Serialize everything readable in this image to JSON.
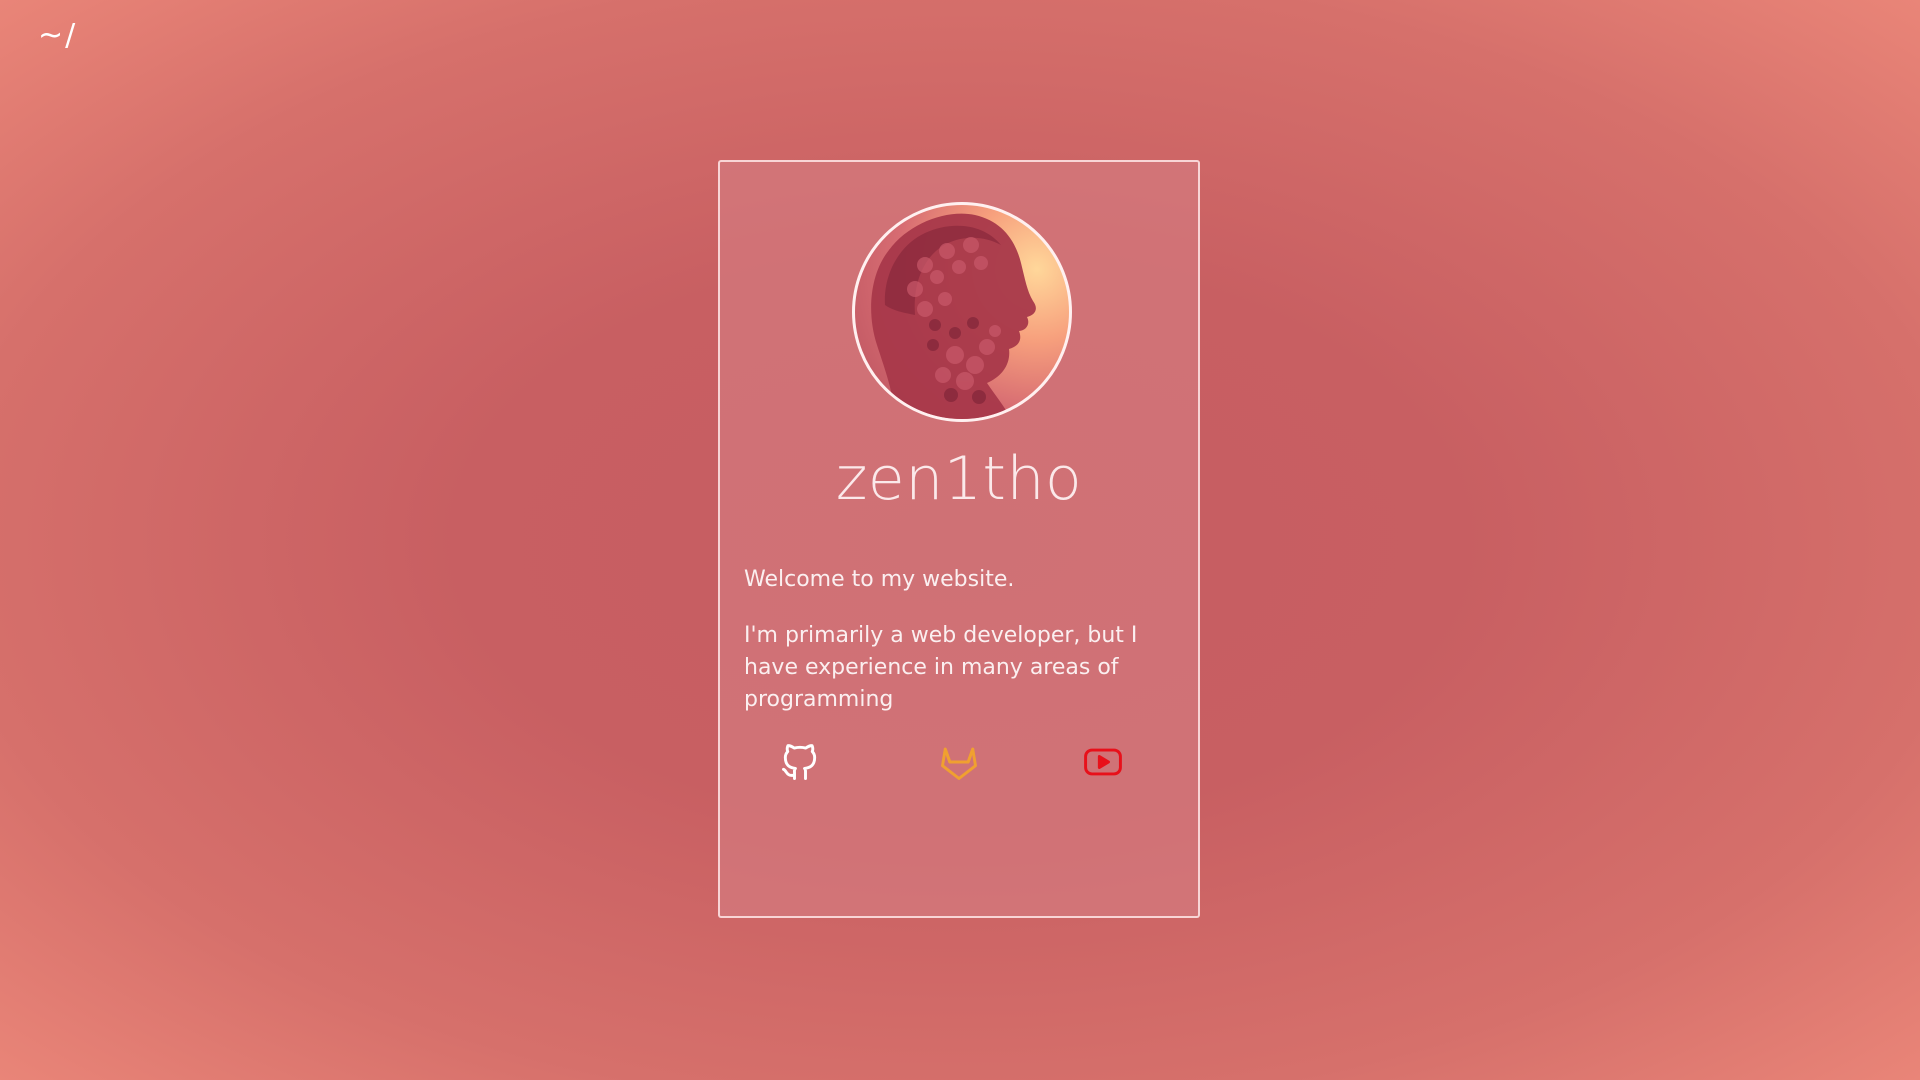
{
  "nav": {
    "home_link": "~/"
  },
  "profile": {
    "name": "zen1tho",
    "welcome": "Welcome to my website.",
    "bio": "I'm primarily a web developer, but I have experience in many areas of programming",
    "avatar_icon": "classical-bust-portrait"
  },
  "socials": [
    {
      "name": "github",
      "icon": "github-icon",
      "color": "#ffffff"
    },
    {
      "name": "gitlab",
      "icon": "gitlab-icon",
      "color": "#f0a030"
    },
    {
      "name": "youtube",
      "icon": "youtube-icon",
      "color": "#e8101a"
    }
  ],
  "colors": {
    "background_center": "#c65d61",
    "background_edge": "#ee8a7b",
    "card_border": "#ffe6e6",
    "text": "#fbeff0"
  }
}
